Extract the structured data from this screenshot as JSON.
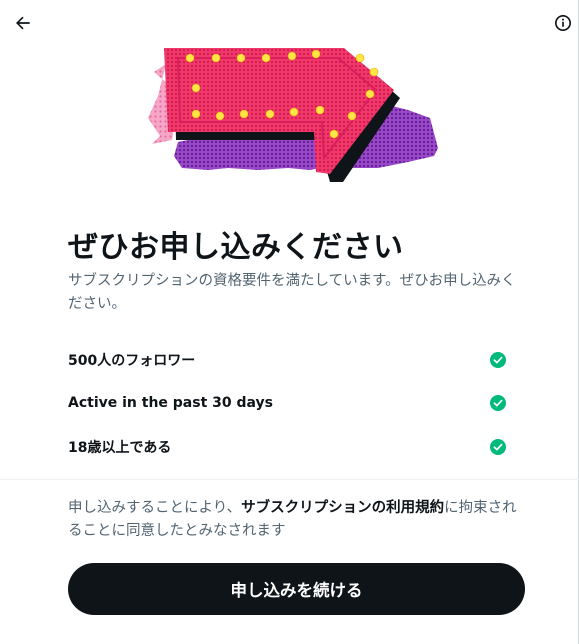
{
  "header": {
    "back_icon": "arrow-left-icon",
    "info_icon": "info-circle-icon"
  },
  "hero": {
    "illustration": "pink-arrow-marquee-illustration",
    "colors": {
      "pink": "#f0386b",
      "purple": "#8e3fbf",
      "yellow": "#ffe347"
    }
  },
  "title": "ぜひお申し込みください",
  "subtitle": "サブスクリプションの資格要件を満たしています。ぜひお申し込みください。",
  "requirements": [
    {
      "label": "500人のフォロワー",
      "icon": "check-circle-icon",
      "met": true
    },
    {
      "label": "Active in the past 30 days",
      "icon": "check-circle-icon",
      "met": true
    },
    {
      "label": "18歳以上である",
      "icon": "check-circle-icon",
      "met": true
    }
  ],
  "terms": {
    "prefix": "申し込みすることにより、",
    "link": "サブスクリプションの利用規約",
    "suffix": "に拘束されることに同意したとみなされます"
  },
  "cta_label": "申し込みを続ける",
  "colors": {
    "check": "#00ba7c",
    "button": "#0f1419",
    "muted": "#536471"
  }
}
